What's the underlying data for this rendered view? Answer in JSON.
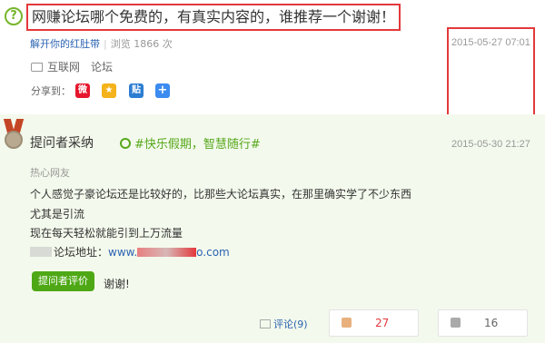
{
  "question": {
    "title": "网赚论坛哪个免费的，有真实内容的，谁推荐一个谢谢！",
    "username": "解开你的红肚带",
    "views": "浏览 1866 次",
    "date": "2015-05-27 07:01",
    "tags": [
      "互联网",
      "论坛"
    ],
    "share_label": "分享到："
  },
  "answer": {
    "title": "提问者采纳",
    "promo": "#快乐假期，智慧随行#",
    "date": "2015-05-30 21:27",
    "source": "热心网友",
    "lines": [
      "个人感觉子豪论坛还是比较好的，比那些大论坛真实，在那里确实学了不少东西",
      "尤其是引流",
      "现在每天轻松就能引到上万流量"
    ],
    "forum_label": "论坛地址：",
    "link_prefix": "www.",
    "link_suffix": "o.com",
    "eval_button": "提问者评价",
    "eval_text": "谢谢!",
    "comment": "评论(9)",
    "upvotes": "27",
    "downvotes": "16"
  },
  "colors": {
    "accent_green": "#4ea816",
    "highlight_red": "#e3393c",
    "link_blue": "#2d64b3",
    "answer_bg": "#f3f9ec"
  }
}
